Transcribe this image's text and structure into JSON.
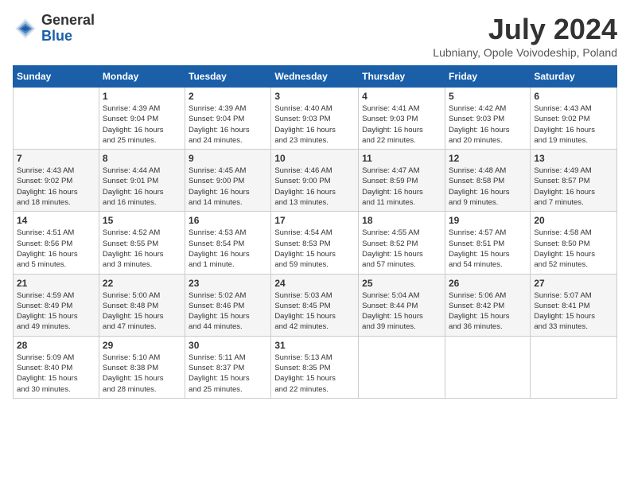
{
  "header": {
    "logo_general": "General",
    "logo_blue": "Blue",
    "month_year": "July 2024",
    "location": "Lubniany, Opole Voivodeship, Poland"
  },
  "days_of_week": [
    "Sunday",
    "Monday",
    "Tuesday",
    "Wednesday",
    "Thursday",
    "Friday",
    "Saturday"
  ],
  "weeks": [
    [
      {
        "day": "",
        "info": ""
      },
      {
        "day": "1",
        "info": "Sunrise: 4:39 AM\nSunset: 9:04 PM\nDaylight: 16 hours\nand 25 minutes."
      },
      {
        "day": "2",
        "info": "Sunrise: 4:39 AM\nSunset: 9:04 PM\nDaylight: 16 hours\nand 24 minutes."
      },
      {
        "day": "3",
        "info": "Sunrise: 4:40 AM\nSunset: 9:03 PM\nDaylight: 16 hours\nand 23 minutes."
      },
      {
        "day": "4",
        "info": "Sunrise: 4:41 AM\nSunset: 9:03 PM\nDaylight: 16 hours\nand 22 minutes."
      },
      {
        "day": "5",
        "info": "Sunrise: 4:42 AM\nSunset: 9:03 PM\nDaylight: 16 hours\nand 20 minutes."
      },
      {
        "day": "6",
        "info": "Sunrise: 4:43 AM\nSunset: 9:02 PM\nDaylight: 16 hours\nand 19 minutes."
      }
    ],
    [
      {
        "day": "7",
        "info": "Sunrise: 4:43 AM\nSunset: 9:02 PM\nDaylight: 16 hours\nand 18 minutes."
      },
      {
        "day": "8",
        "info": "Sunrise: 4:44 AM\nSunset: 9:01 PM\nDaylight: 16 hours\nand 16 minutes."
      },
      {
        "day": "9",
        "info": "Sunrise: 4:45 AM\nSunset: 9:00 PM\nDaylight: 16 hours\nand 14 minutes."
      },
      {
        "day": "10",
        "info": "Sunrise: 4:46 AM\nSunset: 9:00 PM\nDaylight: 16 hours\nand 13 minutes."
      },
      {
        "day": "11",
        "info": "Sunrise: 4:47 AM\nSunset: 8:59 PM\nDaylight: 16 hours\nand 11 minutes."
      },
      {
        "day": "12",
        "info": "Sunrise: 4:48 AM\nSunset: 8:58 PM\nDaylight: 16 hours\nand 9 minutes."
      },
      {
        "day": "13",
        "info": "Sunrise: 4:49 AM\nSunset: 8:57 PM\nDaylight: 16 hours\nand 7 minutes."
      }
    ],
    [
      {
        "day": "14",
        "info": "Sunrise: 4:51 AM\nSunset: 8:56 PM\nDaylight: 16 hours\nand 5 minutes."
      },
      {
        "day": "15",
        "info": "Sunrise: 4:52 AM\nSunset: 8:55 PM\nDaylight: 16 hours\nand 3 minutes."
      },
      {
        "day": "16",
        "info": "Sunrise: 4:53 AM\nSunset: 8:54 PM\nDaylight: 16 hours\nand 1 minute."
      },
      {
        "day": "17",
        "info": "Sunrise: 4:54 AM\nSunset: 8:53 PM\nDaylight: 15 hours\nand 59 minutes."
      },
      {
        "day": "18",
        "info": "Sunrise: 4:55 AM\nSunset: 8:52 PM\nDaylight: 15 hours\nand 57 minutes."
      },
      {
        "day": "19",
        "info": "Sunrise: 4:57 AM\nSunset: 8:51 PM\nDaylight: 15 hours\nand 54 minutes."
      },
      {
        "day": "20",
        "info": "Sunrise: 4:58 AM\nSunset: 8:50 PM\nDaylight: 15 hours\nand 52 minutes."
      }
    ],
    [
      {
        "day": "21",
        "info": "Sunrise: 4:59 AM\nSunset: 8:49 PM\nDaylight: 15 hours\nand 49 minutes."
      },
      {
        "day": "22",
        "info": "Sunrise: 5:00 AM\nSunset: 8:48 PM\nDaylight: 15 hours\nand 47 minutes."
      },
      {
        "day": "23",
        "info": "Sunrise: 5:02 AM\nSunset: 8:46 PM\nDaylight: 15 hours\nand 44 minutes."
      },
      {
        "day": "24",
        "info": "Sunrise: 5:03 AM\nSunset: 8:45 PM\nDaylight: 15 hours\nand 42 minutes."
      },
      {
        "day": "25",
        "info": "Sunrise: 5:04 AM\nSunset: 8:44 PM\nDaylight: 15 hours\nand 39 minutes."
      },
      {
        "day": "26",
        "info": "Sunrise: 5:06 AM\nSunset: 8:42 PM\nDaylight: 15 hours\nand 36 minutes."
      },
      {
        "day": "27",
        "info": "Sunrise: 5:07 AM\nSunset: 8:41 PM\nDaylight: 15 hours\nand 33 minutes."
      }
    ],
    [
      {
        "day": "28",
        "info": "Sunrise: 5:09 AM\nSunset: 8:40 PM\nDaylight: 15 hours\nand 30 minutes."
      },
      {
        "day": "29",
        "info": "Sunrise: 5:10 AM\nSunset: 8:38 PM\nDaylight: 15 hours\nand 28 minutes."
      },
      {
        "day": "30",
        "info": "Sunrise: 5:11 AM\nSunset: 8:37 PM\nDaylight: 15 hours\nand 25 minutes."
      },
      {
        "day": "31",
        "info": "Sunrise: 5:13 AM\nSunset: 8:35 PM\nDaylight: 15 hours\nand 22 minutes."
      },
      {
        "day": "",
        "info": ""
      },
      {
        "day": "",
        "info": ""
      },
      {
        "day": "",
        "info": ""
      }
    ]
  ]
}
